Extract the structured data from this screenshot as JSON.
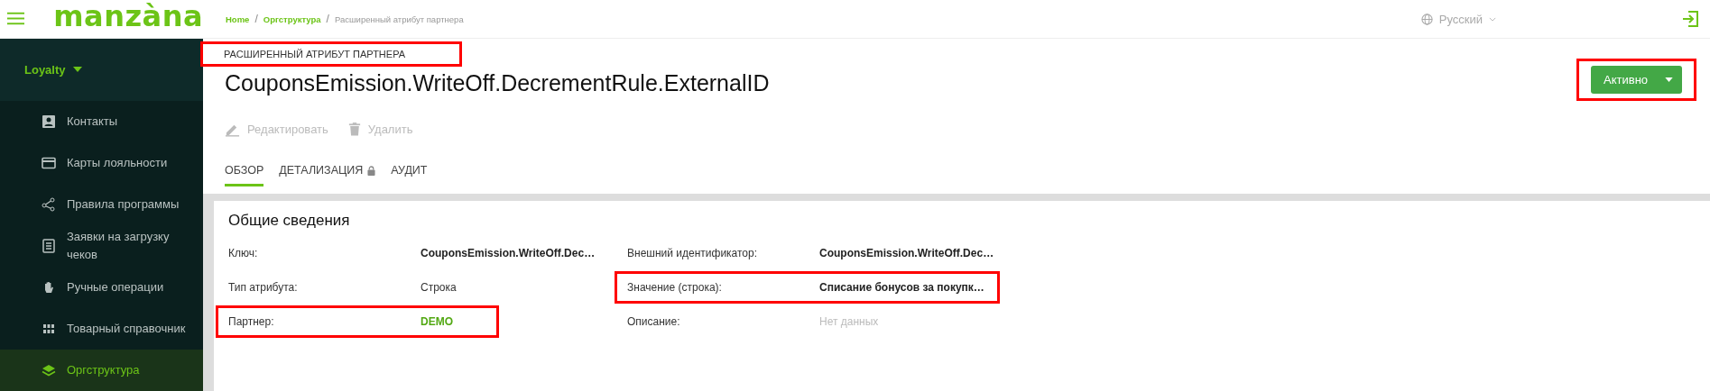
{
  "logo": "manzàna",
  "sidebar": {
    "section": {
      "label": "Loyalty",
      "expanded": true
    },
    "items": [
      {
        "label": "Контакты",
        "kind": "contact",
        "selected": false
      },
      {
        "label": "Карты лояльности",
        "kind": "card",
        "selected": false
      },
      {
        "label": "Правила программы",
        "kind": "share",
        "selected": false
      },
      {
        "label": "Заявки на загрузку чеков",
        "kind": "receipt",
        "selected": false
      },
      {
        "label": "Ручные операции",
        "kind": "hand",
        "selected": false
      },
      {
        "label": "Товарный справочник",
        "kind": "grid",
        "selected": false
      },
      {
        "label": "Оргструктура",
        "kind": "layers",
        "selected": true
      }
    ]
  },
  "breadcrumb": [
    {
      "label": "Home",
      "kind": "link"
    },
    {
      "label": "/",
      "kind": "separator"
    },
    {
      "label": "Оргструктура",
      "kind": "link"
    },
    {
      "label": "/",
      "kind": "separator"
    },
    {
      "label": "Расширенный атрибут партнера",
      "kind": "current"
    }
  ],
  "language": "Русский",
  "page": {
    "label": "РАСШИРЕННЫЙ АТРИБУТ ПАРТНЕРА",
    "label_highlighted": true,
    "title": "CouponsEmission.WriteOff.DecrementRule.ExternalID",
    "status": {
      "label": "Активно",
      "highlighted": true
    },
    "actions": [
      {
        "label": "Редактировать",
        "kind": "edit",
        "disabled": true
      },
      {
        "label": "Удалить",
        "kind": "delete",
        "disabled": true
      }
    ],
    "tabs": [
      {
        "label": "ОБЗОР",
        "selected": true,
        "locked": false
      },
      {
        "label": "ДЕТАЛИЗАЦИЯ",
        "selected": false,
        "locked": true
      },
      {
        "label": "АУДИТ",
        "selected": false,
        "locked": false
      }
    ]
  },
  "card": {
    "title": "Общие сведения",
    "fields": [
      {
        "label": "Ключ:",
        "value": "CouponsEmission.WriteOff.Dec…",
        "kind": "bold",
        "highlighted": false
      },
      {
        "label": "Внешний идентификатор:",
        "value": "CouponsEmission.WriteOff.Dec…",
        "kind": "bold",
        "highlighted": false
      },
      {
        "label": "Тип атрибута:",
        "value": "Строка",
        "kind": "plain",
        "highlighted": false
      },
      {
        "label": "Значение (строка):",
        "value": "Списание бонусов за покупк…",
        "kind": "bold",
        "highlighted": true
      },
      {
        "label": "Партнер:",
        "value": "DEMO",
        "kind": "link",
        "highlighted": true
      },
      {
        "label": "Описание:",
        "value": "Нет данных",
        "kind": "empty",
        "highlighted": false
      }
    ]
  }
}
